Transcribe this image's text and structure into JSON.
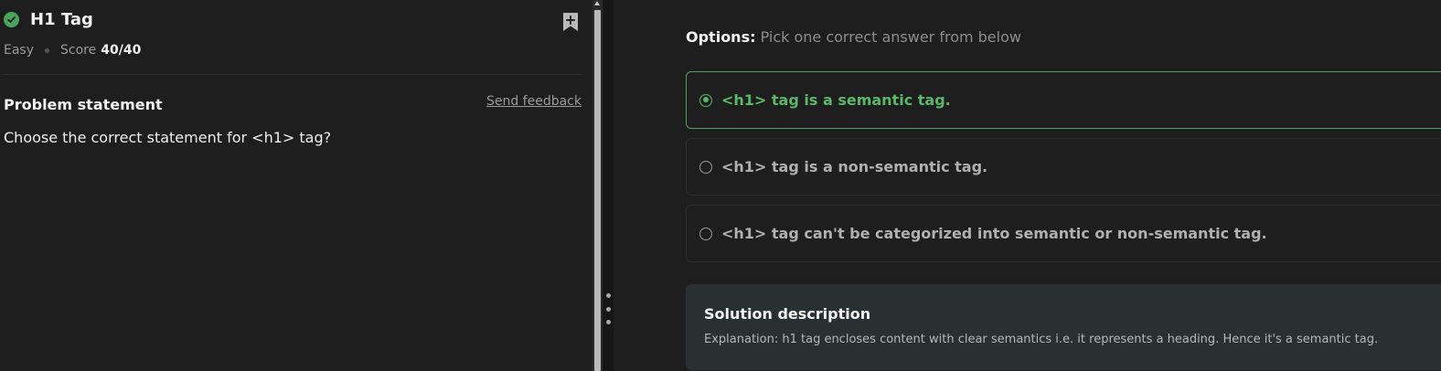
{
  "problem": {
    "title": "H1 Tag",
    "difficulty": "Easy",
    "score_label": "Score",
    "score_value": "40/40",
    "statement_heading": "Problem statement",
    "feedback_link": "Send feedback",
    "question": "Choose the correct statement for <h1> tag?"
  },
  "options": {
    "label": "Options:",
    "instruction": " Pick one correct answer from below",
    "items": [
      {
        "text": "<h1> tag is a semantic tag.",
        "selected": true
      },
      {
        "text": "<h1> tag is a non-semantic tag.",
        "selected": false
      },
      {
        "text": "<h1> tag can't be categorized into semantic or non-semantic tag.",
        "selected": false
      }
    ]
  },
  "solution": {
    "title": "Solution description",
    "text": "Explanation: h1 tag encloses content with clear semantics i.e. it represents a heading. Hence it's a semantic tag."
  },
  "colors": {
    "accent_green": "#5ab869",
    "background": "#1e1e1e",
    "solution_background": "#293031"
  },
  "icons": {
    "solved": "check-circle-icon",
    "bookmark": "bookmark-add-icon",
    "radio": "radio-icon"
  }
}
